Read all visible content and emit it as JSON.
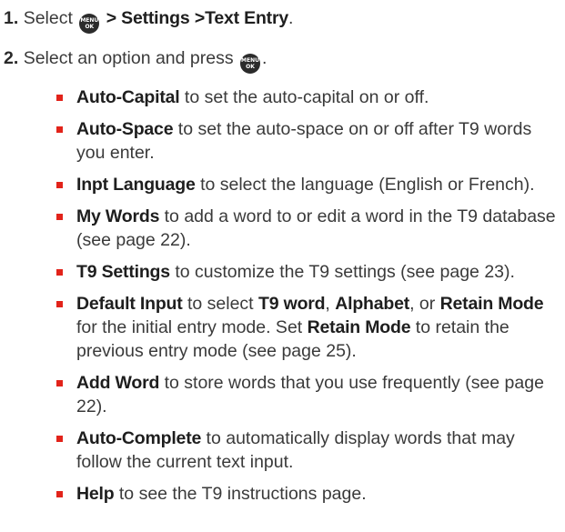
{
  "steps": [
    {
      "number": "1.",
      "pre": "Select",
      "post": "> ",
      "path1": "Settings",
      "path2": "Text Entry",
      "end": "."
    },
    {
      "number": "2.",
      "pre": "Select an option and press",
      "end": "."
    }
  ],
  "key_icon": {
    "line1": "MENU",
    "line2": "OK"
  },
  "options": [
    {
      "bold": "Auto-Capital",
      "text": " to set the auto-capital on or off."
    },
    {
      "bold": "Auto-Space",
      "text": " to set the auto-space on or off after T9 words you enter."
    },
    {
      "bold": "Inpt Language",
      "text": " to select the language (English or French)."
    },
    {
      "bold": "My Words",
      "text": " to add a word to or edit a word in the T9 database (see page 22)."
    },
    {
      "bold": "T9 Settings",
      "text": " to customize the T9 settings (see page 23)."
    },
    {
      "bold": "Add Word",
      "text": " to store words that you use frequently (see page 22)."
    },
    {
      "bold": "Auto-Complete",
      "text": " to automatically display words that may follow the current text input."
    },
    {
      "bold": "Help",
      "text": " to see the T9 instructions page."
    }
  ],
  "default_input": {
    "bold": "Default Input",
    "t1": " to select ",
    "b1": "T9 word",
    "t2": ", ",
    "b2": "Alphabet",
    "t3": ", or ",
    "b3": "Retain Mode",
    "t4": " for the initial entry mode. Set ",
    "b4": "Retain Mode",
    "t5": " to retain the previous entry mode (see page 25)."
  }
}
